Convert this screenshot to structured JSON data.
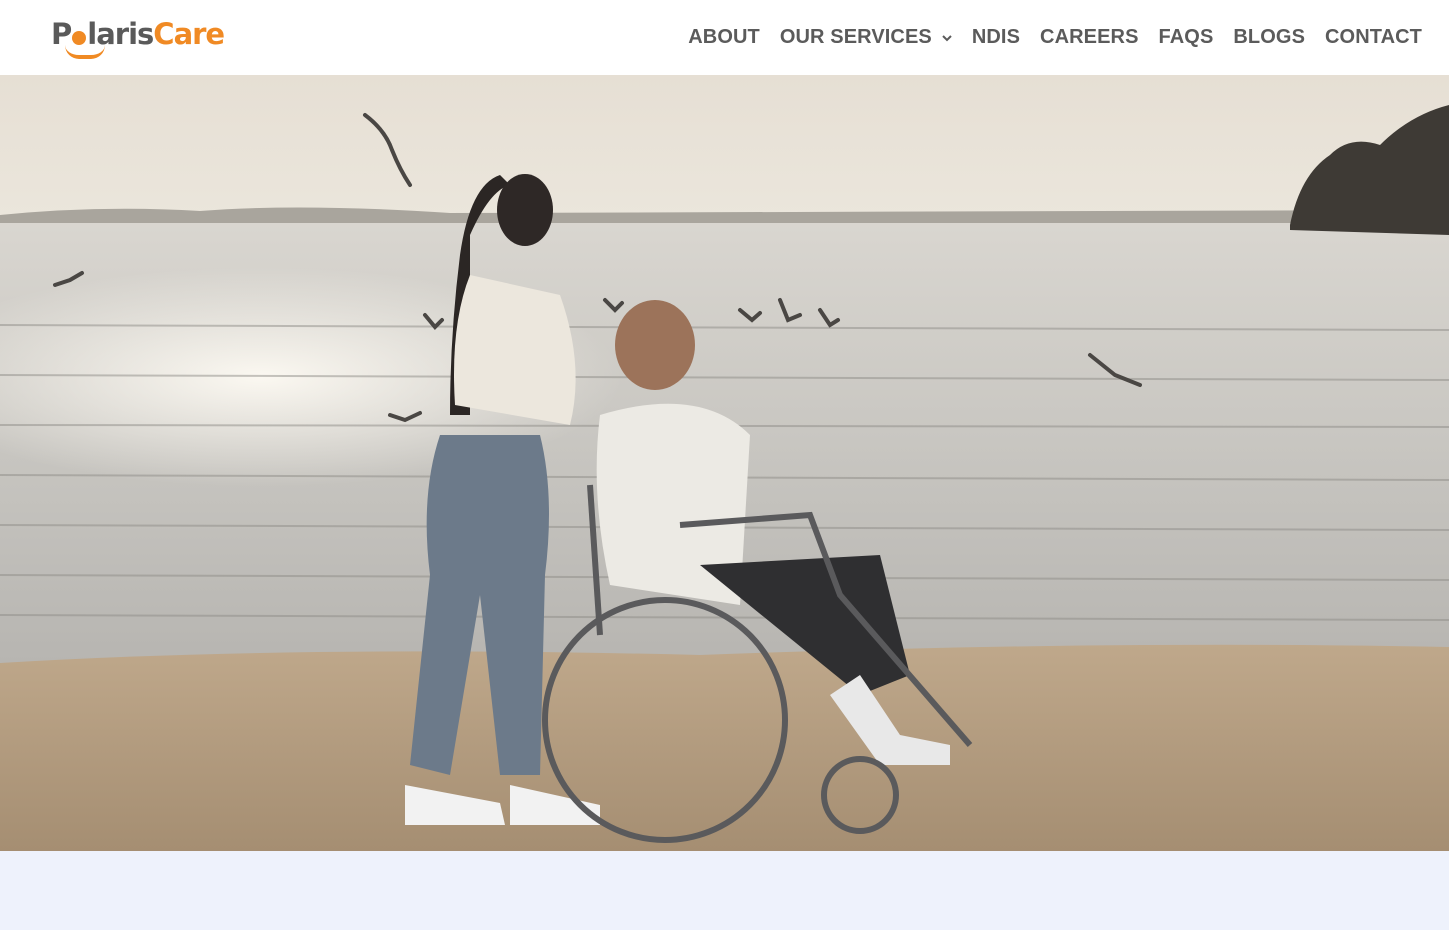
{
  "brand": {
    "name_part1": "P",
    "name_part2": "laris",
    "name_part3": "Care",
    "accent_color": "#f08a24",
    "text_color": "#5a5a5a"
  },
  "nav": {
    "items": [
      {
        "label": "ABOUT"
      },
      {
        "label": "OUR SERVICES",
        "icon": "chevron-down-icon"
      },
      {
        "label": "NDIS"
      },
      {
        "label": "CAREERS"
      },
      {
        "label": "FAQS"
      },
      {
        "label": "BLOGS"
      },
      {
        "label": "CONTACT"
      }
    ]
  },
  "hero": {
    "image_subject": "woman pushing man in wheelchair on beach by water with seagulls at sunset"
  },
  "section_background": "#eef2fc"
}
